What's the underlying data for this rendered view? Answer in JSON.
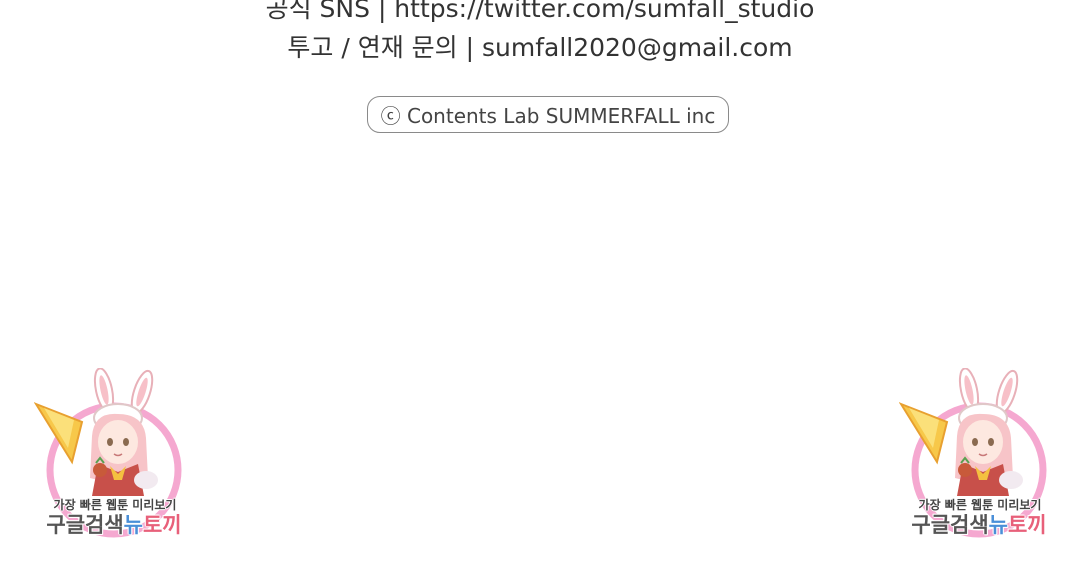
{
  "credits": {
    "sns_line": "공식 SNS | https://twitter.com/sumfall_studio",
    "contact_line": "투고 / 연재 문의 | sumfall2020@gmail.com"
  },
  "copyright": {
    "text": "ⓒ Contents Lab SUMMERFALL inc"
  },
  "watermark": {
    "tagline": "가장 빠른 웹툰 미리보기",
    "name_part1": "구글검색",
    "name_part2": "뉴",
    "name_part3": "토끼",
    "colors": {
      "ring": "#f5a8d0",
      "name_dark": "#555555",
      "name_blue": "#4a8fd8",
      "name_pink": "#e8607a"
    }
  }
}
